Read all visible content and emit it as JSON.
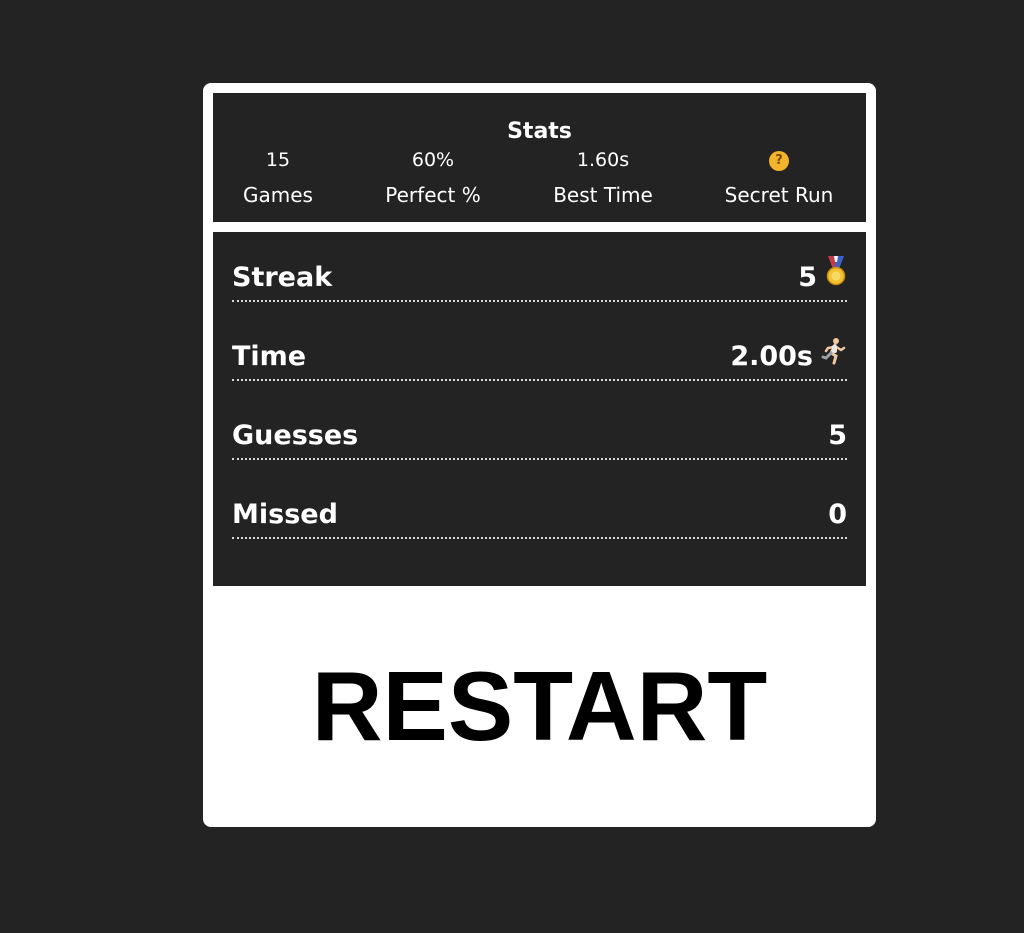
{
  "stats": {
    "title": "Stats",
    "items": [
      {
        "value": "15",
        "label": "Games"
      },
      {
        "value": "60%",
        "label": "Perfect %"
      },
      {
        "value": "1.60s",
        "label": "Best Time"
      },
      {
        "value": "",
        "label": "Secret Run",
        "icon": "secret-question-icon"
      }
    ]
  },
  "round": {
    "rows": [
      {
        "label": "Streak",
        "value": "5",
        "icon": "medal-icon"
      },
      {
        "label": "Time",
        "value": "2.00s",
        "icon": "running-person-icon"
      },
      {
        "label": "Guesses",
        "value": "5"
      },
      {
        "label": "Missed",
        "value": "0"
      }
    ]
  },
  "restart_label": "RESTART",
  "colors": {
    "background": "#232323",
    "card": "#ffffff",
    "text_light": "#ffffff",
    "text_dark": "#000000"
  }
}
